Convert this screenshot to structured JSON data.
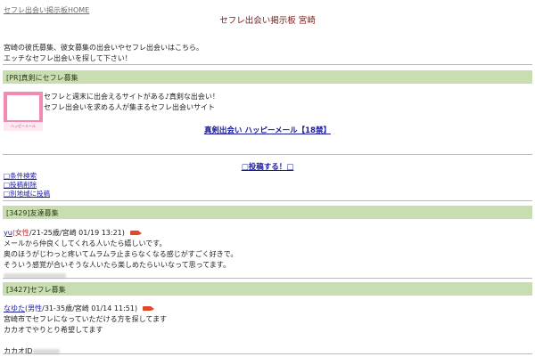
{
  "header": {
    "home_link": "セフレ出会い掲示板HOME",
    "title": "セフレ出会い掲示板 宮崎"
  },
  "intro": {
    "line1": "宮崎の彼氏募集、彼女募集の出会いやセフレ出会いはこちら。",
    "line2": "エッチなセフレ出会いを探して下さい！"
  },
  "pr": {
    "heading": "[PR]真剣にセフレ募集",
    "line1": "セフレと週末に出会えるサイトがある♪真剣な出会い！",
    "line2": "セフレ出会いを求める人が集まるセフレ出会いサイト",
    "link": "真剣出会い ハッピーメール【18禁】",
    "banner_caption": "ハッピーメール"
  },
  "actions": {
    "post": "□投稿する！□",
    "search": "□条件検索",
    "delete": "□投稿削除",
    "other_region": "□別地域に投稿"
  },
  "posts": [
    {
      "heading": "[3429]友達募集",
      "name": "yu",
      "gender": "(女性",
      "meta": "/21-25歳/宮崎 01/19 13:21)",
      "lines": [
        "メールから仲良くしてくれる人いたら嬉しいです。",
        "奥のほうがじわっと疼いてムラムラ止まらなくなる感じがすごく好きで。",
        "そういう感覚が合いそうな人いたら楽しめたらいいなって思ってます。"
      ]
    },
    {
      "heading": "[3427]セフレ募集",
      "name": "なゆた",
      "gender": "(男性",
      "meta": "/31-35歳/宮崎 01/14 11:51)",
      "lines": [
        "宮崎市でセフレになっていただける方を探してます",
        "カカオでやりとり希望してます"
      ],
      "contact_label": "カカオID"
    }
  ],
  "colors": {
    "band": "#c9deb0",
    "title": "#7a1b1b",
    "link": "#1a1aa0"
  }
}
